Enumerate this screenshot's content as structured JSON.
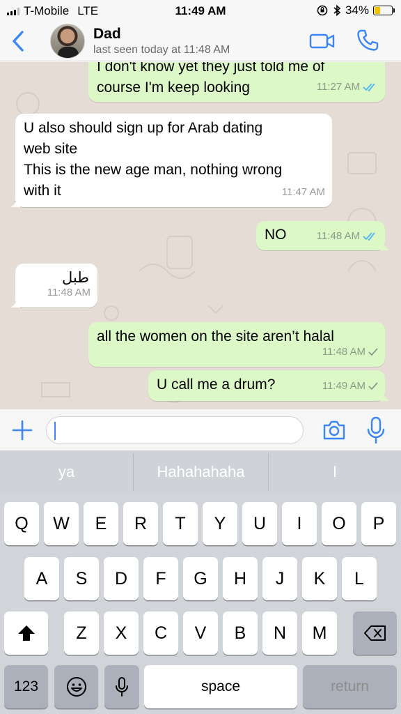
{
  "status_bar": {
    "carrier": "T-Mobile",
    "network": "LTE",
    "time": "11:49 AM",
    "battery_percent": "34%",
    "battery_level": 0.34
  },
  "header": {
    "back_label": "",
    "contact_name": "Dad",
    "last_seen": "last seen today at 11:48 AM",
    "accent_color": "#3a86f7"
  },
  "messages": [
    {
      "direction": "out",
      "text": "I don't know yet they just told me of\ncourse I'm keep looking",
      "time": "11:27 AM",
      "status": "read"
    },
    {
      "direction": "in",
      "text": "U also should sign up for Arab dating\nweb site\nThis is the new age man, nothing wrong\nwith it",
      "time": "11:47 AM"
    },
    {
      "direction": "out",
      "text": "NO",
      "time": "11:48 AM",
      "status": "read"
    },
    {
      "direction": "in",
      "text": "طبل",
      "time": "11:48 AM"
    },
    {
      "direction": "out",
      "text": "all the women on the site aren’t halal",
      "time": "11:48 AM",
      "status": "sent"
    },
    {
      "direction": "out",
      "text": "U call me a drum?",
      "time": "11:49 AM",
      "status": "sent"
    }
  ],
  "input": {
    "value": "",
    "placeholder": ""
  },
  "keyboard": {
    "suggestions": [
      "ya",
      "Hahahahaha",
      "I"
    ],
    "row1": [
      "Q",
      "W",
      "E",
      "R",
      "T",
      "Y",
      "U",
      "I",
      "O",
      "P"
    ],
    "row2": [
      "A",
      "S",
      "D",
      "F",
      "G",
      "H",
      "J",
      "K",
      "L"
    ],
    "row3": [
      "Z",
      "X",
      "C",
      "V",
      "B",
      "N",
      "M"
    ],
    "numbers_label": "123",
    "space_label": "space",
    "return_label": "return"
  },
  "icons": {
    "back": "chevron-left-icon",
    "video": "video-camera-icon",
    "call": "phone-icon",
    "plus": "plus-icon",
    "camera": "camera-icon",
    "mic": "microphone-icon",
    "shift": "shift-arrow-icon",
    "delete": "backspace-icon",
    "emoji": "emoji-icon",
    "dictation": "microphone-icon"
  }
}
